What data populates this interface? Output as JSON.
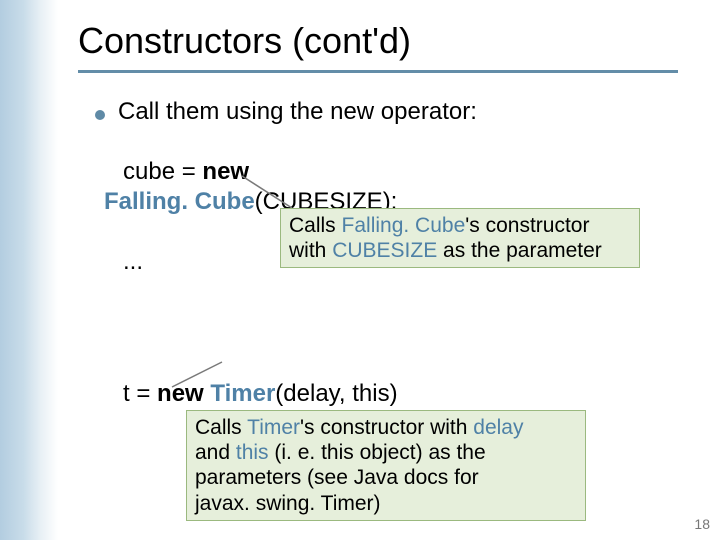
{
  "slide": {
    "title": "Constructors (cont'd)",
    "bullet1": "Call them using the new operator:",
    "code1a_prefix": "cube = ",
    "code1a_new": "new",
    "code1b_ident": "Falling. Cube",
    "code1b_rest": "(CUBESIZE);",
    "callout1_line1_a": "Calls ",
    "callout1_line1_b": "Falling. Cube",
    "callout1_line1_c": "'s constructor",
    "callout1_line2_a": "with ",
    "callout1_line2_b": "CUBESIZE",
    "callout1_line2_c": " as the parameter",
    "dots": "...",
    "code2_prefix": "t = ",
    "code2_new": "new ",
    "code2_ident": "Timer",
    "code2_rest": "(delay, this)",
    "callout2_line1_a": "Calls ",
    "callout2_line1_b": "Timer",
    "callout2_line1_c": "'s constructor with ",
    "callout2_line1_d": "delay",
    "callout2_line2_a": "and ",
    "callout2_line2_b": "this",
    "callout2_line2_c": " (i. e. this object) as the",
    "callout2_line3": "parameters (see Java docs for",
    "callout2_line4": "javax. swing. Timer)",
    "number": "18"
  }
}
